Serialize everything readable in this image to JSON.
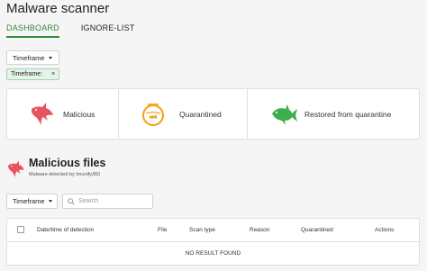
{
  "page": {
    "title": "Malware scanner"
  },
  "tabs": [
    {
      "label": "DASHBOARD",
      "active": true
    },
    {
      "label": "IGNORE-LIST",
      "active": false
    }
  ],
  "filters": {
    "timeframe_label": "Timeframe",
    "chip_label": "Timeframe:",
    "chip_close": "×"
  },
  "stats": [
    {
      "label": "Malicious",
      "icon": "shark-icon",
      "color": "#e8545d"
    },
    {
      "label": "Quarantined",
      "icon": "fishbowl-icon",
      "color": "#f5a623"
    },
    {
      "label": "Restored from quarantine",
      "icon": "fish-icon",
      "color": "#3fae4f"
    }
  ],
  "section": {
    "title": "Malicious files",
    "subtitle": "Malware detected by Imunify360"
  },
  "controls": {
    "timeframe_label": "Timeframe",
    "search_placeholder": "Search"
  },
  "table": {
    "columns": [
      "Date/time of detection",
      "File",
      "Scan type",
      "Reason",
      "Quarantined",
      "Actions"
    ],
    "empty_text": "NO RESULT FOUND"
  },
  "colors": {
    "accent": "#2f8a3b",
    "danger": "#e8545d",
    "warning": "#f5a623",
    "success": "#3fae4f"
  }
}
